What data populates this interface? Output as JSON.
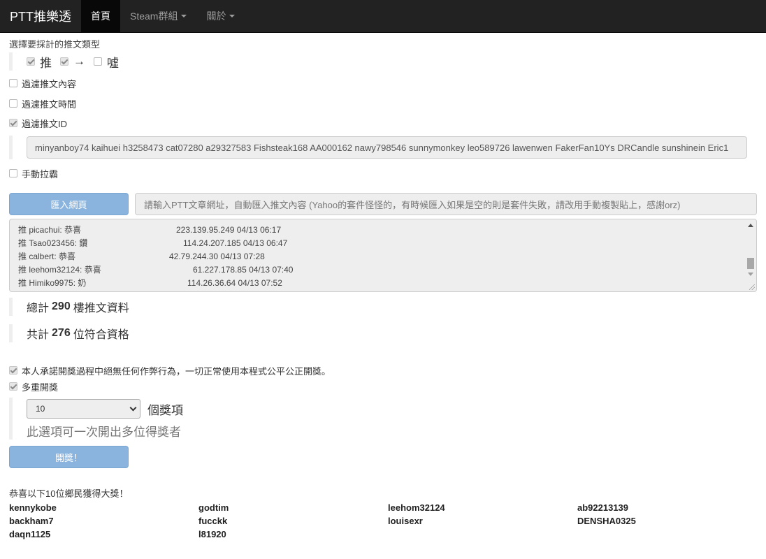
{
  "navbar": {
    "brand": "PTT推樂透",
    "items": [
      {
        "label": "首頁",
        "active": true,
        "dropdown": false
      },
      {
        "label": "Steam群組",
        "active": false,
        "dropdown": true
      },
      {
        "label": "關於",
        "active": false,
        "dropdown": true
      }
    ]
  },
  "push_types": {
    "label": "選擇要採計的推文類型",
    "options": [
      {
        "label": "推",
        "checked": true
      },
      {
        "label": "→",
        "checked": true
      },
      {
        "label": "噓",
        "checked": false
      }
    ]
  },
  "filters": {
    "content": {
      "label": "過濾推文內容",
      "checked": false
    },
    "time": {
      "label": "過濾推文時間",
      "checked": false
    },
    "id": {
      "label": "過濾推文ID",
      "checked": true
    },
    "id_value": "minyanboy74 kaihuei h3258473 cat07280 a29327583 Fishsteak168 AA000162 nawy798546 sunnymonkey leo589726 lawenwen FakerFan10Ys DRCandle sunshinein Eric1",
    "manual": {
      "label": "手動拉霸",
      "checked": false
    }
  },
  "import": {
    "button_label": "匯入網頁",
    "placeholder": "請輸入PTT文章網址，自動匯入推文內容 (Yahoo的套件怪怪的，有時候匯入如果是空的則是套件失敗，請改用手動複製貼上，感謝orz)"
  },
  "push_lines": [
    {
      "text": "推 picachui: 恭喜",
      "meta": "223.139.95.249 04/13 06:17"
    },
    {
      "text": "推 Tsao023456: 鑽",
      "meta": "114.24.207.185 04/13 06:47"
    },
    {
      "text": "推 calbert: 恭喜",
      "meta": "42.79.244.30 04/13 07:28"
    },
    {
      "text": "推 leehom32124: 恭喜",
      "meta": "61.227.178.85 04/13 07:40"
    },
    {
      "text": "推 Himiko9975: 奶",
      "meta": "114.26.36.64 04/13 07:52"
    }
  ],
  "stats": {
    "total_prefix": "總計",
    "total": "290",
    "total_suffix": "樓推文資料",
    "eligible_prefix": "共計",
    "eligible": "276",
    "eligible_suffix": "位符合資格"
  },
  "pledge": {
    "label": "本人承諾開獎過程中絕無任何作弊行為，一切正常使用本程式公平公正開獎。",
    "checked": true
  },
  "multi": {
    "label": "多重開獎",
    "checked": true,
    "selected": "10",
    "unit": "個獎項",
    "hint": "此選項可一次開出多位得獎者"
  },
  "draw_button": "開獎！",
  "result": {
    "title": "恭喜以下10位鄉民獲得大獎！",
    "winners": [
      "kennykobe",
      "godtim",
      "leehom32124",
      "ab92213139",
      "backham7",
      "fucckk",
      "louisexr",
      "DENSHA0325",
      "daqn1125",
      "l81920"
    ]
  },
  "icons": [
    "checkbox-icon",
    "caret-down-icon",
    "chevron-down-icon",
    "scroll-up-icon",
    "scroll-down-icon",
    "resize-handle-icon"
  ],
  "colors": {
    "navbar_bg": "#222222",
    "button_primary": "#8ab4de",
    "input_bg": "#eeeeee"
  }
}
